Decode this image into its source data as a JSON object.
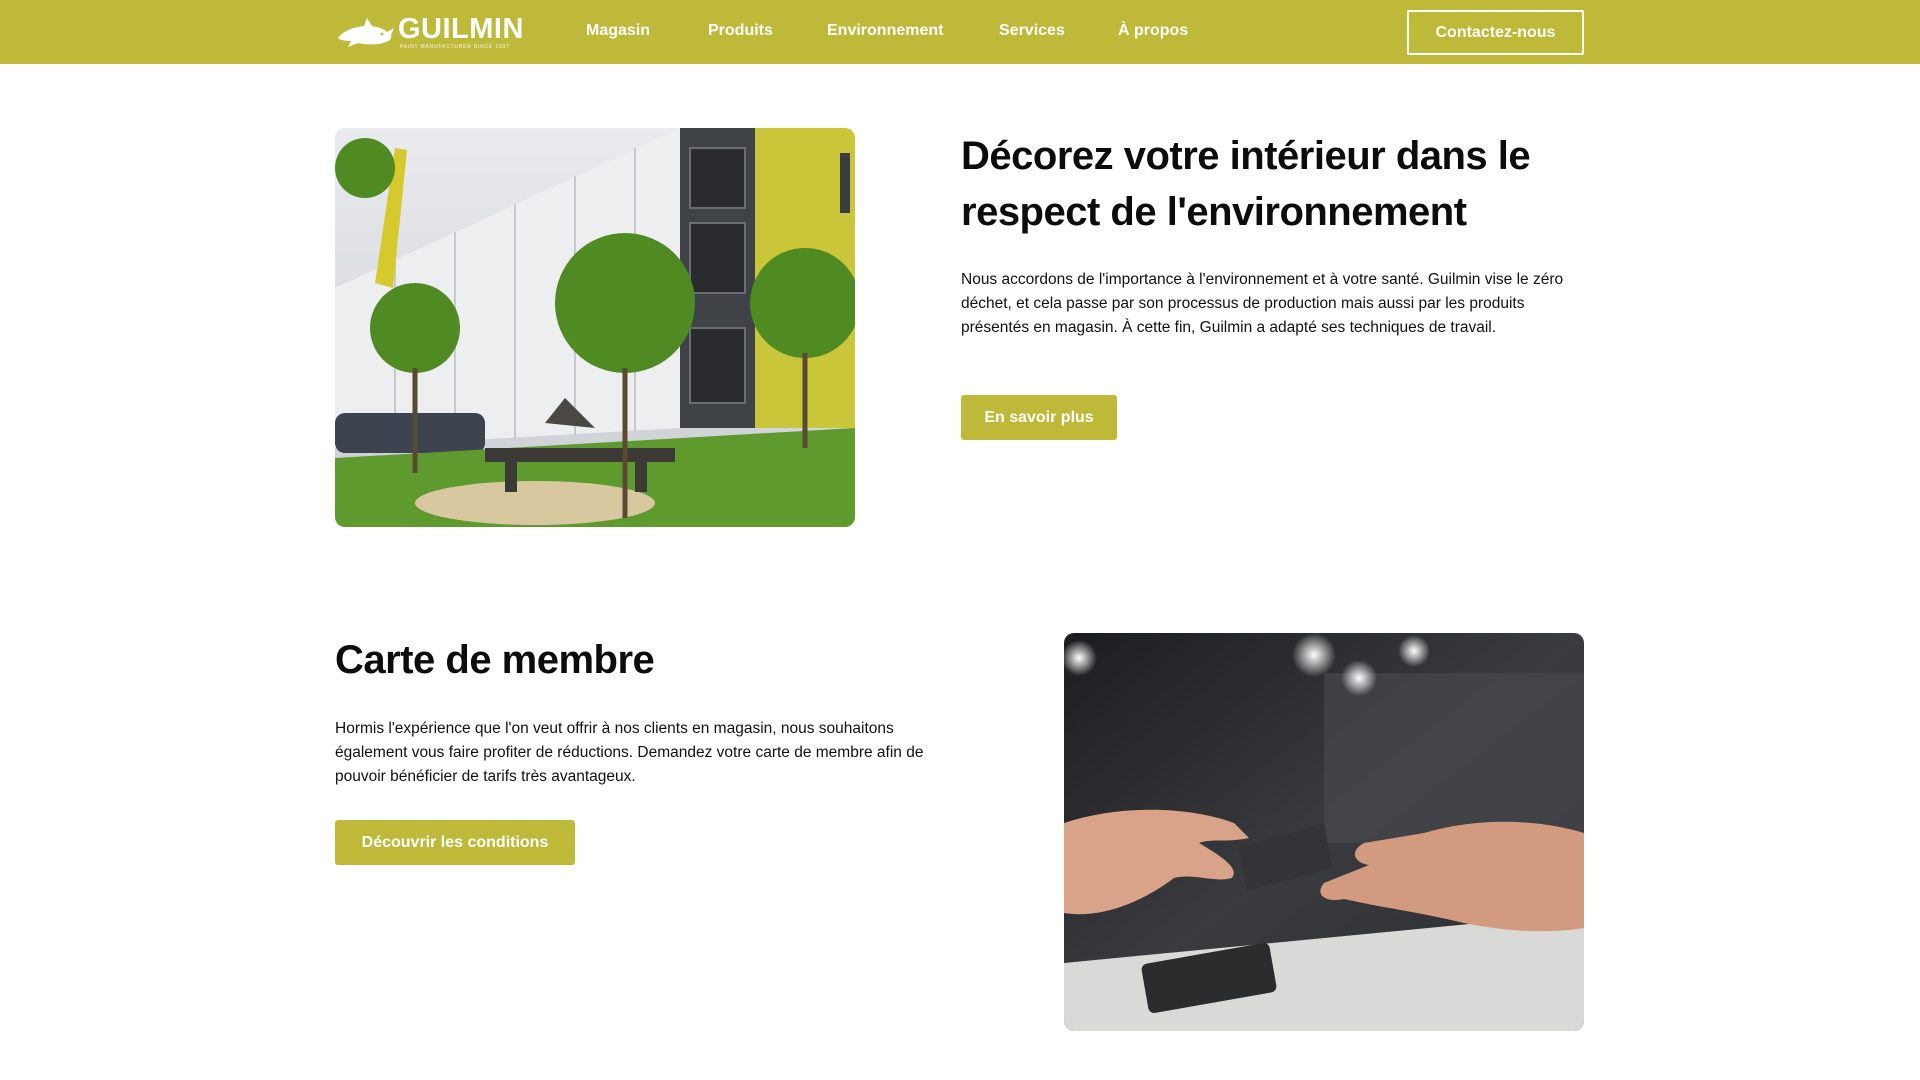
{
  "header": {
    "logo": {
      "word": "GUILMIN",
      "tagline": "PAINT MANUFACTURER SINCE 1937",
      "icon": "dolphin-logo-icon"
    },
    "nav": [
      "Magasin",
      "Produits",
      "Environnement",
      "Services",
      "À propos"
    ],
    "contact_label": "Contactez-nous"
  },
  "environment": {
    "title": "Décorez votre intérieur dans le respect de l'environnement",
    "body": "Nous accordons de l'importance à l'environnement et à votre santé. Guilmin vise le zéro déchet, et cela passe par son processus de production mais aussi par les produits présentés en magasin. À cette fin, Guilmin a adapté ses techniques de travail.",
    "cta": "En savoir plus"
  },
  "membership": {
    "title": "Carte de membre",
    "body": "Hormis l'expérience que l'on veut offrir à nos clients en magasin, nous souhaitons également vous faire profiter de réductions. Demandez votre carte de membre afin de pouvoir bénéficier de tarifs très avantageux.",
    "cta": "Découvrir les conditions"
  },
  "colors": {
    "brand": "#bfb93a",
    "text": "#111111",
    "background": "#ffffff"
  }
}
